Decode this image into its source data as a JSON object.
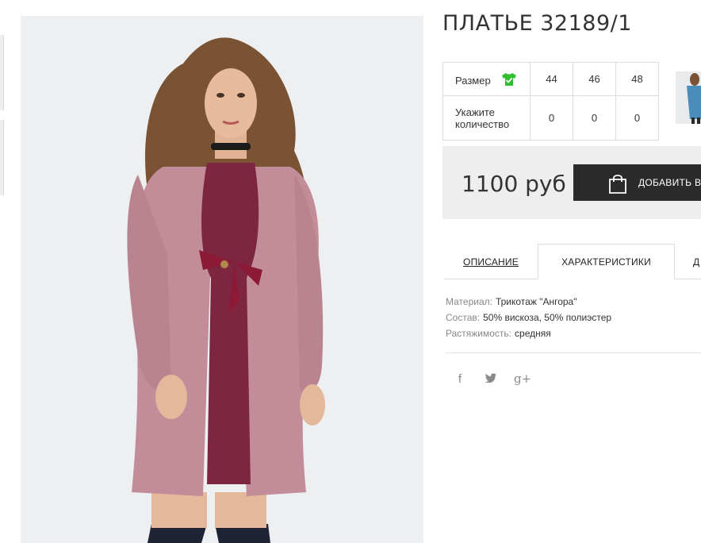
{
  "product": {
    "title": "ПЛАТЬЕ 32189/1",
    "price": "1100 руб",
    "add_to_cart_label": "ДОБАВИТЬ В КОРЗИНУ"
  },
  "size_table": {
    "size_label": "Размер",
    "quantity_label": "Укажите количество",
    "sizes": [
      "44",
      "46",
      "48"
    ],
    "quantities": [
      "0",
      "0",
      "0"
    ]
  },
  "tabs": {
    "description": "ОПИСАНИЕ",
    "characteristics": "ХАРАКТЕРИСТИКИ",
    "more": "Д"
  },
  "specs": [
    {
      "key": "Материал:",
      "value": "Трикотаж \"Ангора\""
    },
    {
      "key": "Состав:",
      "value": "50% вискоза, 50% полиэстер"
    },
    {
      "key": "Растяжимость:",
      "value": "средняя"
    }
  ],
  "social": {
    "facebook": "f",
    "twitter": "t",
    "googleplus": "g+"
  },
  "colors": {
    "tee_icon": "#2fbf2f",
    "button_bg": "#2b2b2b",
    "buy_box_bg": "#eeeeee"
  }
}
